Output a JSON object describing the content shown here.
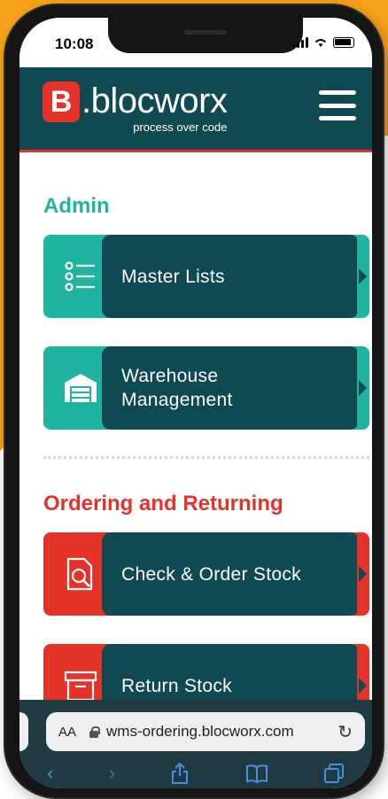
{
  "status_bar": {
    "time": "10:08"
  },
  "header": {
    "logo_mark": "B",
    "logo_text": ".blocworx",
    "logo_tagline": "process over code"
  },
  "sections": [
    {
      "title": "Admin",
      "color": "#1fb3a2",
      "items": [
        {
          "label": "Master Lists",
          "icon": "list-icon"
        },
        {
          "label": "Warehouse\nManagement",
          "icon": "warehouse-icon"
        }
      ]
    },
    {
      "title": "Ordering and Returning",
      "color": "#e6332a",
      "items": [
        {
          "label": "Check & Order Stock",
          "icon": "search-document-icon"
        },
        {
          "label": "Return Stock",
          "icon": "archive-box-icon"
        }
      ]
    }
  ],
  "browser": {
    "text_size": "AA",
    "url": "wms-ordering.blocworx.com",
    "reload_icon": "reload-icon",
    "toolbar_icons": [
      "back-icon",
      "forward-icon",
      "share-icon",
      "bookmarks-icon",
      "tabs-icon"
    ]
  },
  "colors": {
    "header_bg": "#0f4a52",
    "teal": "#1fb3a2",
    "red": "#e6332a",
    "accent_orange": "#f7a21a"
  }
}
